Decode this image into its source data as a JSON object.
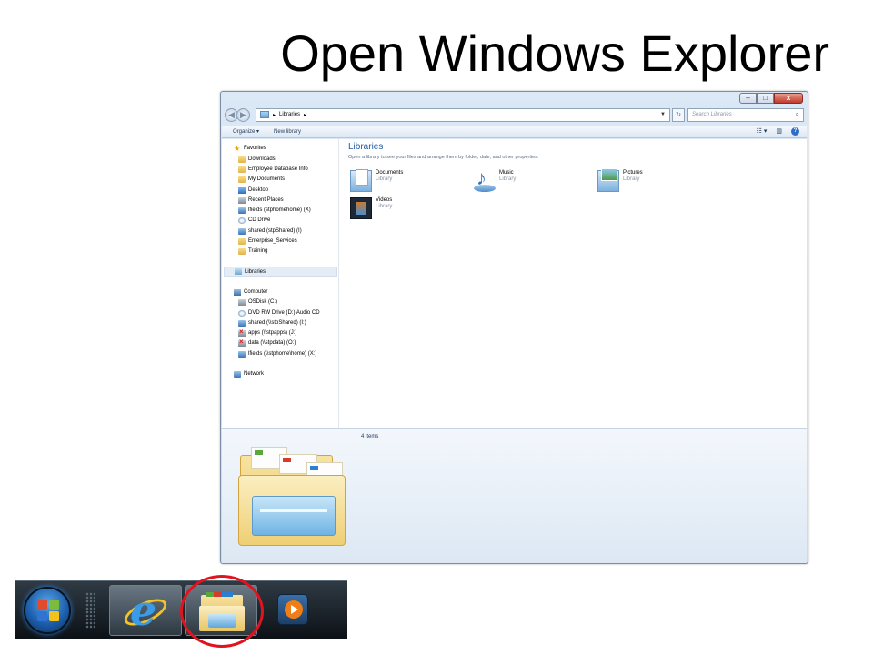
{
  "slide": {
    "title": "Open Windows Explorer"
  },
  "window": {
    "caption_buttons": {
      "minimize": "–",
      "maximize": "□",
      "close": "x"
    },
    "nav": {
      "back": "◀",
      "forward": "▶"
    },
    "address": {
      "separator1": "▸",
      "path_label": "Libraries",
      "separator2": "▸",
      "dropdown": "▼"
    },
    "refresh": "↻",
    "search": {
      "placeholder": "Search Libraries",
      "icon": "search-icon"
    },
    "commands": {
      "organize": "Organize ▾",
      "new_library": "New library",
      "view": "☷ ▾",
      "pane": "▥",
      "help": "?"
    },
    "nav_pane": {
      "favorites": "Favorites",
      "favorite_items": [
        "Downloads",
        "Employee Database Info",
        "My Documents",
        "Desktop",
        "Recent Places",
        "lfields (stphomehome) (X)",
        "CD Drive",
        "shared (stpShared) (I)",
        "Enterprise_Services",
        "Training"
      ],
      "libraries": "Libraries",
      "computer": "Computer",
      "computer_items": [
        "OSDisk (C:)",
        "DVD RW Drive (D:) Audio CD",
        "shared (\\\\stpShared) (I:)",
        "apps (\\\\stpapps) (J:)",
        "data (\\\\stpdata) (O:)",
        "lfields (\\\\stphome\\home) (X:)"
      ],
      "network": "Network"
    },
    "content": {
      "heading": "Libraries",
      "description": "Open a library to see your files and arrange them by folder, date, and other properties.",
      "libraries": [
        {
          "name": "Documents",
          "kind": "Library",
          "icon": "documents-library-icon"
        },
        {
          "name": "Music",
          "kind": "Library",
          "icon": "music-library-icon"
        },
        {
          "name": "Pictures",
          "kind": "Library",
          "icon": "pictures-library-icon"
        },
        {
          "name": "Videos",
          "kind": "Library",
          "icon": "videos-library-icon"
        }
      ]
    },
    "details": {
      "count": "4 items"
    }
  },
  "taskbar": {
    "items": [
      "start-orb-icon",
      "internet-explorer-icon",
      "windows-explorer-icon",
      "media-player-icon"
    ],
    "highlight_color": "#e0141e"
  }
}
